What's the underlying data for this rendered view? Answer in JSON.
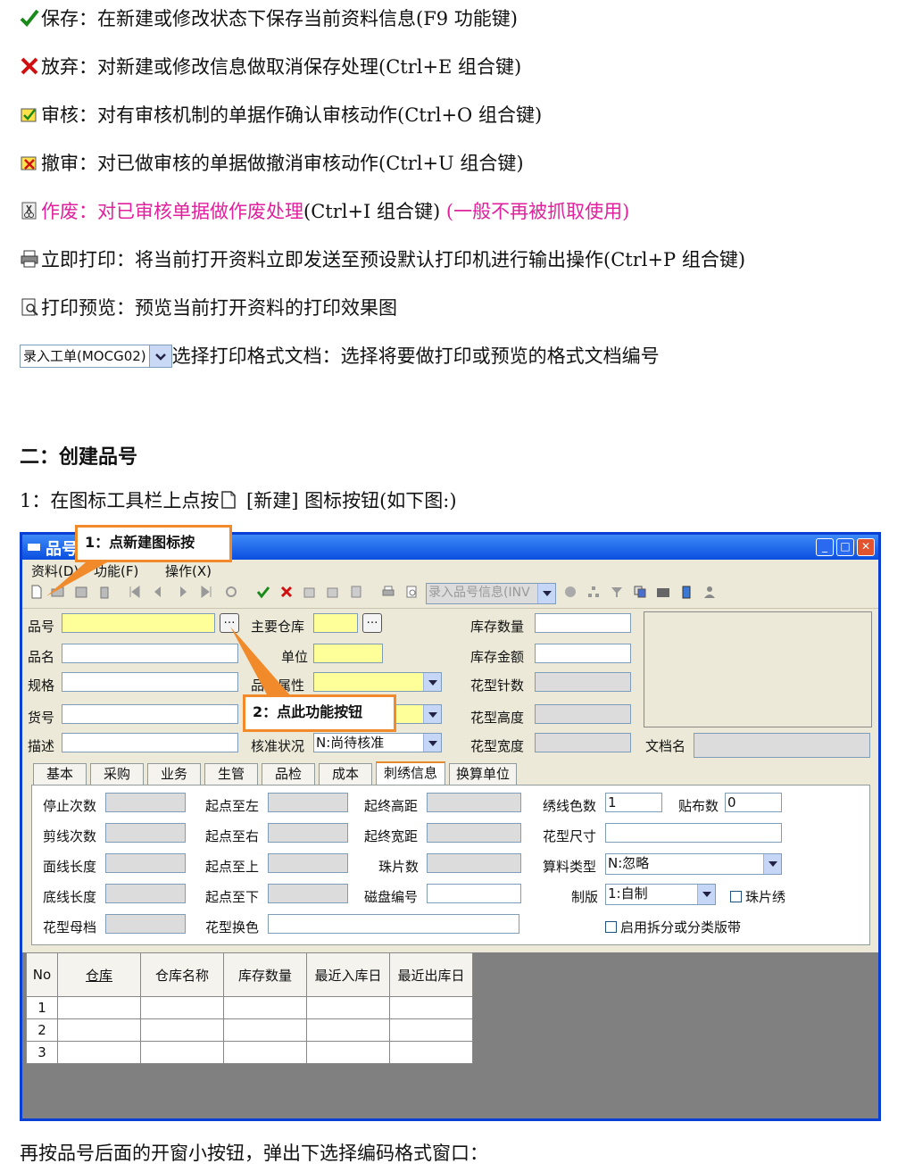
{
  "lines": [
    {
      "label": "保存：",
      "text": "在新建或修改状态下保存当前资料信息(F9 功能键)"
    },
    {
      "label": "放弃：",
      "text": "对新建或修改信息做取消保存处理(Ctrl+E 组合键)"
    },
    {
      "label": "审核：",
      "text": "对有审核机制的单据作确认审核动作(Ctrl+O 组合键)"
    },
    {
      "label": "撤审：",
      "text": "对已做审核的单据做撤消审核动作(Ctrl+U 组合键)"
    },
    {
      "label": "作废：对已审核单据做作废处理",
      "text": "(Ctrl+I 组合键)",
      "extra": "(一般不再被抓取使用)"
    },
    {
      "label": "立即打印：",
      "text": "将当前打开资料立即发送至预设默认打印机进行输出操作(Ctrl+P 组合键)"
    },
    {
      "label": "打印预览：",
      "text": "预览当前打开资料的打印效果图"
    }
  ],
  "format_combo": {
    "value": "录入工单(MOCG02)",
    "text": "选择打印格式文档：选择将要做打印或预览的格式文档编号"
  },
  "section_heading": "二：创建品号",
  "step1": {
    "prefix": "1：在图标工具栏上点按",
    "suffix": " [新建] 图标按钮(如下图:)"
  },
  "window": {
    "title": "品号",
    "menus": [
      "资料(D)",
      "功能(F)",
      "操作(X)"
    ],
    "toolbar_combo": "录入品号信息(INV",
    "fields_left": [
      "品号",
      "品名",
      "规格",
      "货号",
      "描述"
    ],
    "main_warehouse_label": "主要仓库",
    "unit_label": "单位",
    "attr_label": "品号属性",
    "approve_label": "核准状况",
    "approve_value": "N:尚待核准",
    "fields_right": [
      "库存数量",
      "库存金额",
      "花型针数",
      "花型高度",
      "花型宽度"
    ],
    "doc_name_label": "文档名",
    "tabs": [
      "基本",
      "采购",
      "业务",
      "生管",
      "品检",
      "成本",
      "刺绣信息",
      "换算单位"
    ],
    "panel": {
      "col1": [
        "停止次数",
        "剪线次数",
        "面线长度",
        "底线长度",
        "花型母档"
      ],
      "col2": [
        "起点至左",
        "起点至右",
        "起点至上",
        "起点至下",
        "花型换色"
      ],
      "col3": [
        "起终高距",
        "起终宽距",
        "珠片数",
        "磁盘编号"
      ],
      "thread_colors_label": "绣线色数",
      "thread_colors_value": "1",
      "patch_label": "贴布数",
      "patch_value": "0",
      "size_label": "花型尺寸",
      "calc_type_label": "算料类型",
      "calc_type_value": "N:忽略",
      "plate_label": "制版",
      "plate_value": "1:自制",
      "sequin_label": "珠片绣",
      "split_label": "启用拆分或分类版带"
    },
    "grid_headers": [
      "No",
      "仓库",
      "仓库名称",
      "库存数量",
      "最近入库日",
      "最近出库日"
    ],
    "grid_rows": [
      "1",
      "2",
      "3"
    ]
  },
  "callout1": "1：点新建图标按",
  "callout2": "2：点此功能按钮",
  "bottom_text": "再按品号后面的开窗小按钮，弹出下选择编码格式窗口：",
  "colors": {
    "accent_pink": "#e0209c",
    "callout_orange": "#f08a2a",
    "title_blue": "#0a4ee0"
  }
}
